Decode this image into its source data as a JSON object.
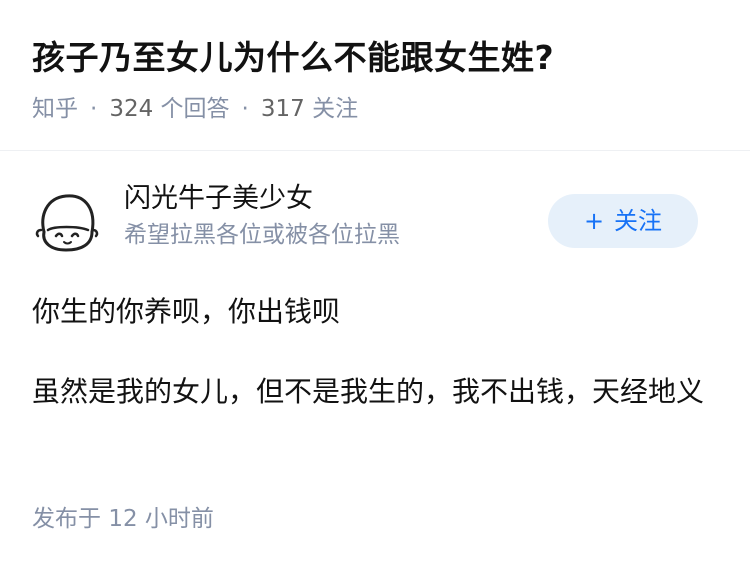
{
  "question": {
    "title": "孩子乃至女儿为什么不能跟女生姓?",
    "source": "知乎",
    "answer_count": "324",
    "answer_label": "个回答",
    "follower_count": "317",
    "follower_label": "关注"
  },
  "author": {
    "name": "闪光牛子美少女",
    "bio": "希望拉黑各位或被各位拉黑",
    "avatar_icon": "doodle-face-avatar"
  },
  "follow_button": {
    "plus": "+",
    "label": "关注"
  },
  "answer": {
    "paragraphs": [
      "你生的你养呗，你出钱呗",
      "虽然是我的女儿，但不是我生的，我不出钱，天经地义"
    ],
    "published_label": "发布于",
    "published_time": "12 小时前"
  },
  "colors": {
    "accent": "#1772f6",
    "accent_bg": "#e6f0fa",
    "meta_text": "#8590a6",
    "main_text": "#121212"
  }
}
